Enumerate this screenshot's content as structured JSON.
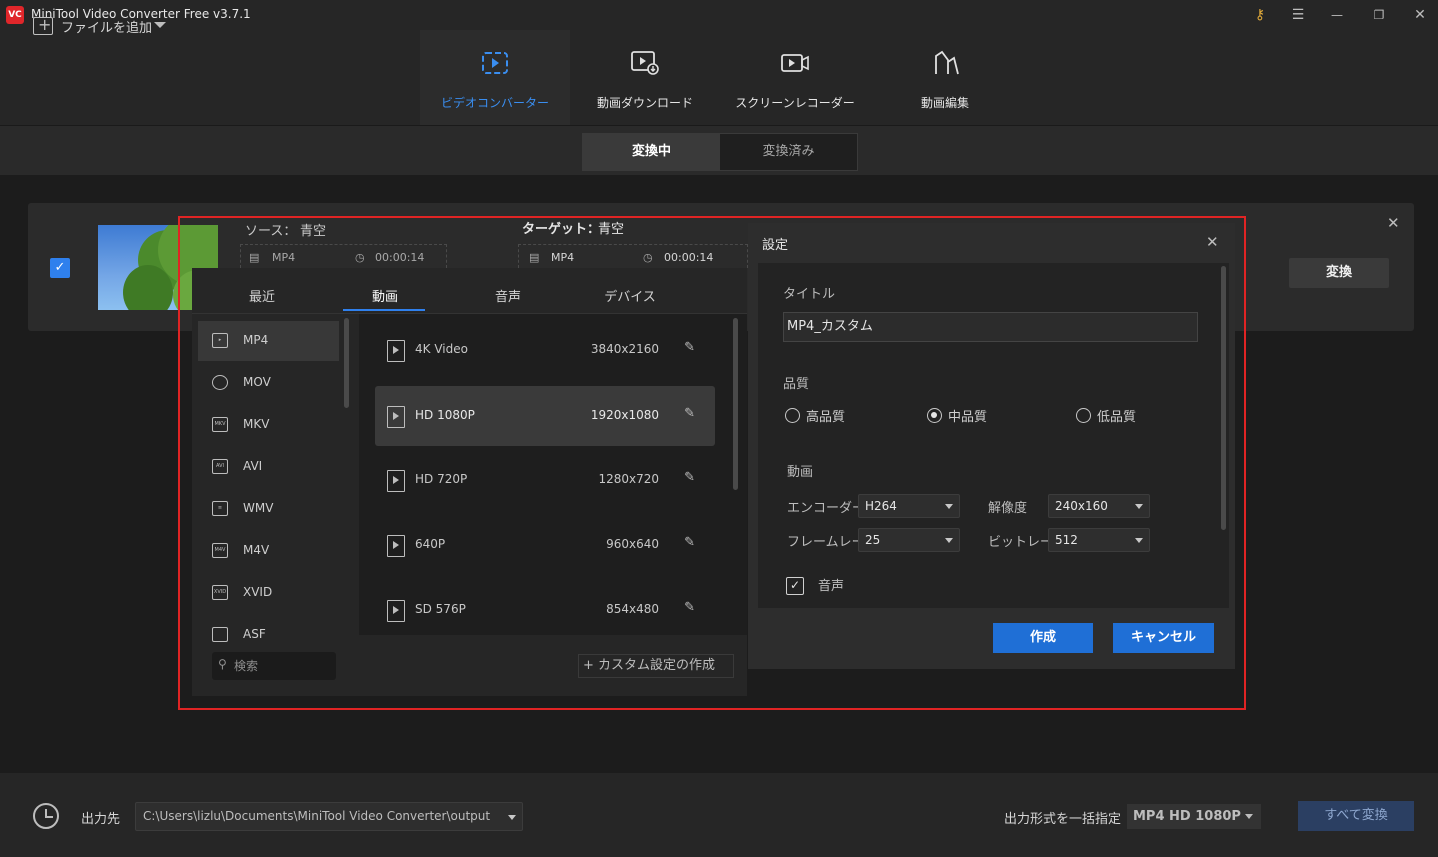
{
  "window": {
    "title": "MiniTool Video Converter Free v3.7.1",
    "logo_text": "VC"
  },
  "window_controls": {
    "key": "⚷",
    "menu": "☰",
    "minimize": "—",
    "restore": "❐",
    "close": "✕"
  },
  "nav": {
    "items": [
      {
        "label": "ビデオコンバーター",
        "icon": "convert-icon",
        "active": true
      },
      {
        "label": "動画ダウンロード",
        "icon": "download-icon",
        "active": false
      },
      {
        "label": "スクリーンレコーダー",
        "icon": "record-icon",
        "active": false
      },
      {
        "label": "動画編集",
        "icon": "edit-icon",
        "active": false
      }
    ]
  },
  "toolbar": {
    "add_file": "ファイルを追加",
    "tab_converting": "変換中",
    "tab_converted": "変換済み"
  },
  "file": {
    "checked": true,
    "source_label": "ソース：",
    "source_name": "青空",
    "source_format": "MP4",
    "source_duration": "00:00:14",
    "target_label": "ターゲット：",
    "target_name": "青空",
    "target_format": "MP4",
    "target_duration": "00:00:14",
    "convert_label": "変換",
    "close": "✕"
  },
  "format_panel": {
    "tabs": [
      "最近",
      "動画",
      "音声",
      "デバイス"
    ],
    "active_tab": "動画",
    "formats": [
      "MP4",
      "MOV",
      "MKV",
      "AVI",
      "WMV",
      "M4V",
      "XVID",
      "ASF"
    ],
    "format_icon_text": [
      "",
      "",
      "MKV",
      "AVI",
      "",
      "M4V",
      "XVID",
      ""
    ],
    "active_format": "MP4",
    "search_placeholder": "検索",
    "presets": [
      {
        "name": "4K Video",
        "resolution": "3840x2160"
      },
      {
        "name": "HD 1080P",
        "resolution": "1920x1080"
      },
      {
        "name": "HD 720P",
        "resolution": "1280x720"
      },
      {
        "name": "640P",
        "resolution": "960x640"
      },
      {
        "name": "SD 576P",
        "resolution": "854x480"
      }
    ],
    "active_preset": "HD 1080P",
    "custom_button": "+ カスタム設定の作成"
  },
  "settings": {
    "title": "設定",
    "close": "✕",
    "title_field_label": "タイトル",
    "title_value": "MP4_カスタム",
    "quality_label": "品質",
    "quality_options": [
      "高品質",
      "中品質",
      "低品質"
    ],
    "quality_selected": "中品質",
    "video_label": "動画",
    "encoder_label": "エンコーダー",
    "encoder_value": "H264",
    "resolution_label": "解像度",
    "resolution_value": "240x160",
    "framerate_label": "フレームレート",
    "framerate_value": "25",
    "bitrate_label": "ビットレート",
    "bitrate_value": "512",
    "audio_label": "音声",
    "audio_checked": true,
    "create_button": "作成",
    "cancel_button": "キャンセル"
  },
  "bottom": {
    "output_label": "出力先",
    "output_path": "C:\\Users\\lizlu\\Documents\\MiniTool Video Converter\\output",
    "batch_label": "出力形式を一括指定",
    "batch_value": "MP4 HD 1080P",
    "convert_all": "すべて変換"
  },
  "colors": {
    "accent": "#2f80ed",
    "highlight": "#e02424",
    "primary_button": "#1f6fd6"
  }
}
